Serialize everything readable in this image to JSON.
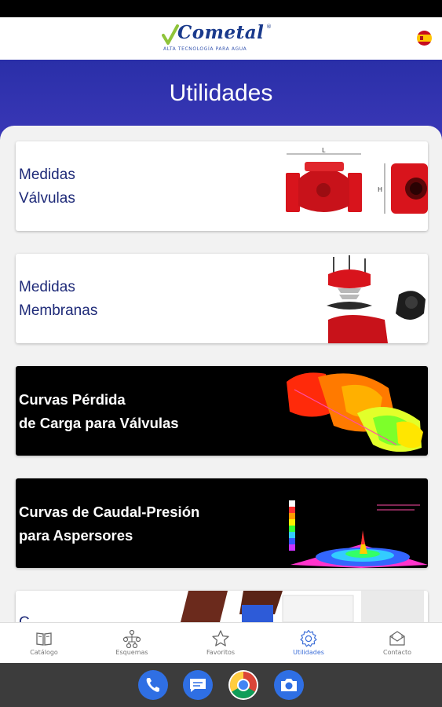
{
  "header": {
    "logo_text": "Cometal",
    "logo_reg": "®",
    "logo_tagline": "ALTA TECNOLOGÍA PARA AGUA",
    "language_flag": "spain-flag-icon"
  },
  "hero": {
    "title": "Utilidades"
  },
  "cards": [
    {
      "title": "Medidas\nVálvulas",
      "theme": "light",
      "image": "valve-dimensions-image"
    },
    {
      "title": "Medidas\nMembranas",
      "theme": "light",
      "image": "membrane-exploded-image"
    },
    {
      "title": "Curvas Pérdida\nde Carga para Válvulas",
      "theme": "dark",
      "image": "valve-heatmap-image"
    },
    {
      "title": "Curvas de Caudal-Presión\npara Aspersores",
      "theme": "dark",
      "image": "sprinkler-pressure-image"
    },
    {
      "title": "C",
      "theme": "light",
      "image": "partial-card-image"
    }
  ],
  "bottom_nav": {
    "items": [
      {
        "label": "Catálogo",
        "icon": "book-icon",
        "active": false
      },
      {
        "label": "Esquemas",
        "icon": "diagram-icon",
        "active": false
      },
      {
        "label": "Favoritos",
        "icon": "star-icon",
        "active": false
      },
      {
        "label": "Utilidades",
        "icon": "gear-icon",
        "active": true
      },
      {
        "label": "Contacto",
        "icon": "contact-icon",
        "active": false
      }
    ]
  },
  "dock": {
    "apps": [
      {
        "name": "phone-app-icon",
        "color": "#2f6fe4"
      },
      {
        "name": "messages-app-icon",
        "color": "#2f6fe4"
      },
      {
        "name": "chrome-app-icon",
        "color": "#ffffff"
      },
      {
        "name": "camera-app-icon",
        "color": "#2f6fe4"
      }
    ]
  },
  "colors": {
    "brand_blue": "#1a3a8c",
    "hero_bg": "#2a2fa8",
    "active_nav": "#3d6fd8",
    "valve_red": "#d8141c"
  }
}
